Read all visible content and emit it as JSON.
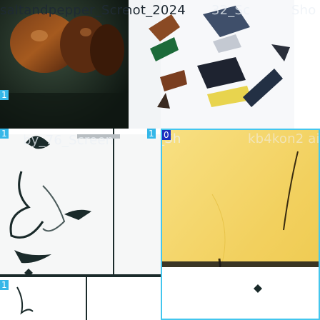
{
  "tiles": [
    {
      "name": "food-photo-tile",
      "caption": "saltandpepper_Scree",
      "index_label": "1"
    },
    {
      "name": "mechanical-parts-tile",
      "caption": "hot_2024",
      "index_label": "1",
      "extra_caption": "32_Sc",
      "right_caption": "Sho"
    },
    {
      "name": "cracked-vase-tile",
      "caption": "by_76_Screen",
      "index_label": "1",
      "bottom_index_label": "1"
    },
    {
      "name": "yellow-fabric-tile",
      "caption": "_Sh",
      "index_label": "0",
      "tag": "kb4kon2 ai"
    }
  ],
  "colors": {
    "selection_border": "#43c6ee",
    "badge_bg": "#35b7e8",
    "food_bg": "#2a3a2f",
    "parts_bg": "#f4f6f8",
    "gray_bg": "#a8a8a8",
    "yellow_bg": "#f2d260"
  }
}
